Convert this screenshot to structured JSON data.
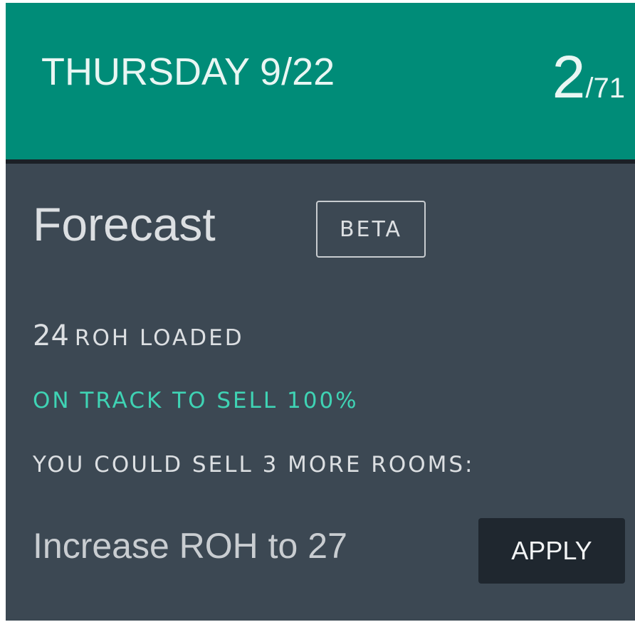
{
  "header": {
    "day_label": "THURSDAY 9/22",
    "count_current": "2",
    "count_total": "/71"
  },
  "forecast": {
    "title": "Forecast",
    "badge": "BETA",
    "loaded_count": "24",
    "loaded_text": "ROH LOADED",
    "status": "ON TRACK TO SELL 100%",
    "suggestion": "YOU COULD SELL 3 MORE ROOMS:",
    "action_text": "Increase ROH to 27",
    "apply_label": "APPLY"
  },
  "colors": {
    "header_bg": "#008c78",
    "body_bg": "#3c4853",
    "accent_green": "#3fd3b4",
    "button_bg": "#1f272f"
  }
}
